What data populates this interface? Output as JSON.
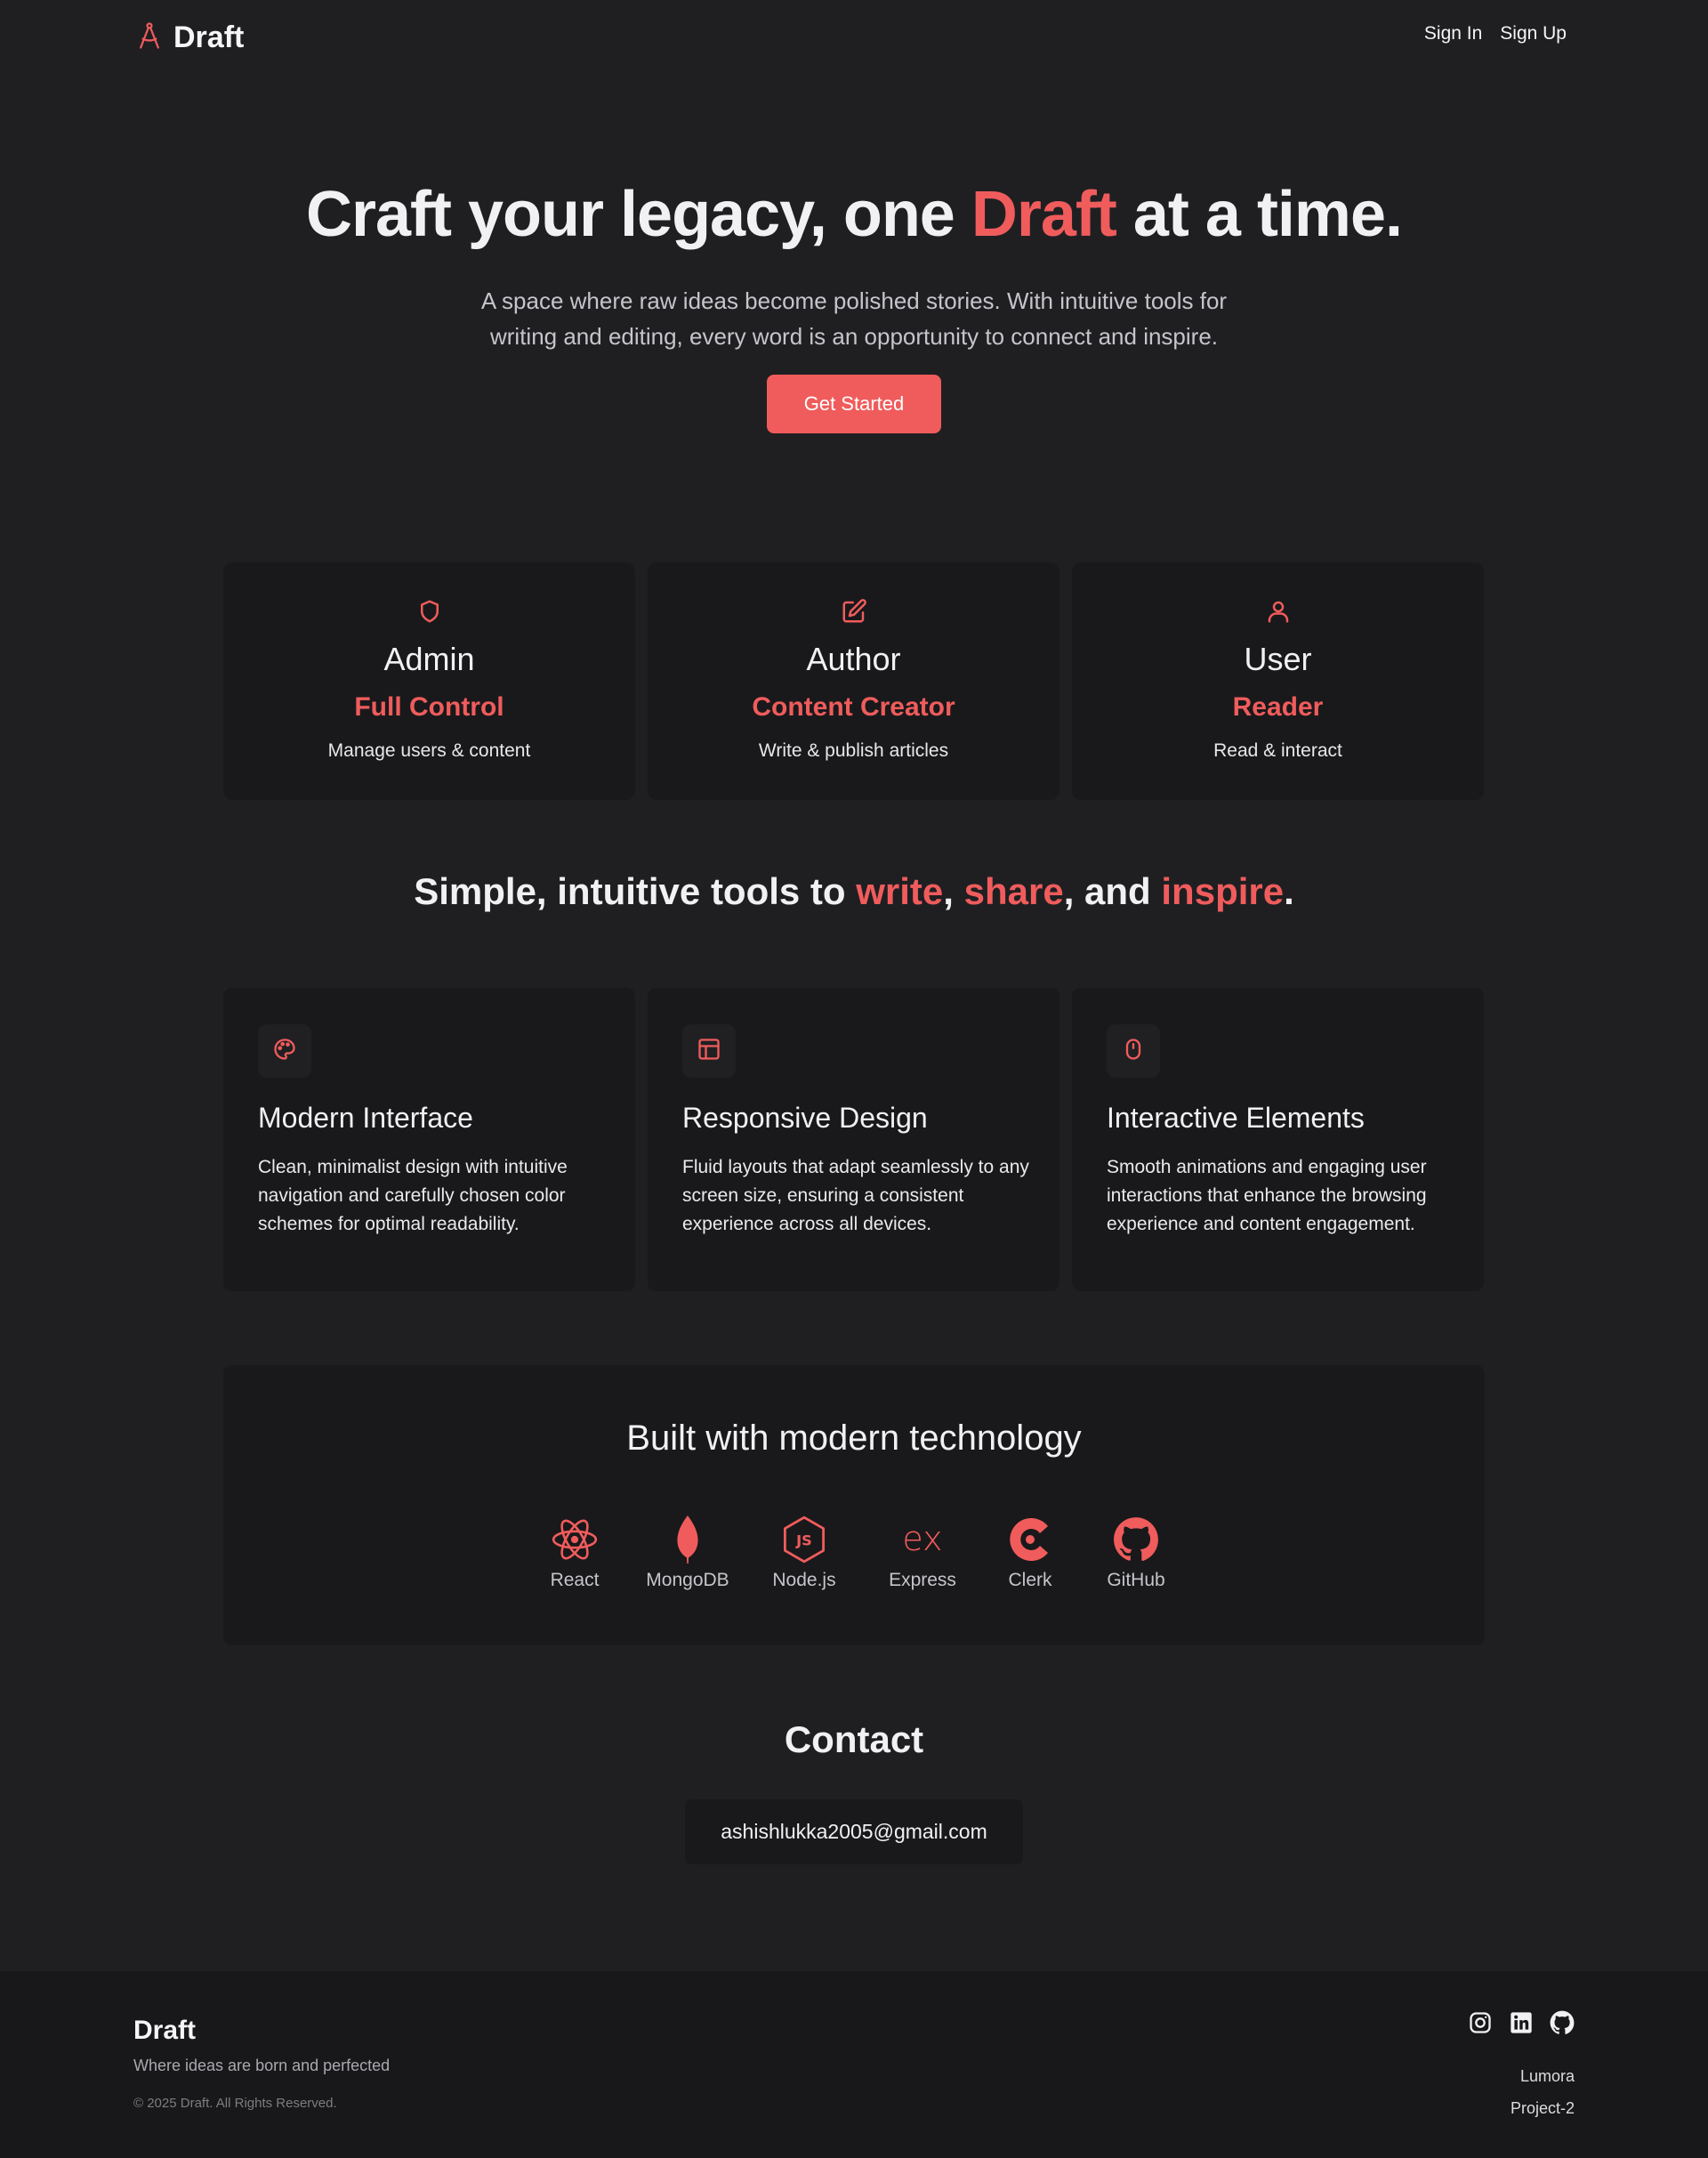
{
  "header": {
    "brand": "Draft",
    "sign_in": "Sign In",
    "sign_up": "Sign Up"
  },
  "hero": {
    "title_before": "Craft your legacy, one ",
    "title_accent": "Draft",
    "title_after": " at a time.",
    "subtitle_line1": "A space where raw ideas become polished stories. With intuitive tools for",
    "subtitle_line2": "writing and editing, every word is an opportunity to connect and inspire.",
    "cta": "Get Started"
  },
  "roles": [
    {
      "icon": "shield-icon",
      "title": "Admin",
      "subtitle": "Full Control",
      "desc": "Manage users & content"
    },
    {
      "icon": "pencil-square-icon",
      "title": "Author",
      "subtitle": "Content Creator",
      "desc": "Write & publish articles"
    },
    {
      "icon": "user-icon",
      "title": "User",
      "subtitle": "Reader",
      "desc": "Read & interact"
    }
  ],
  "tools_heading": {
    "p1": "Simple, intuitive tools to ",
    "w1": "write",
    "p2": ", ",
    "w2": "share",
    "p3": ", and ",
    "w3": "inspire",
    "p4": "."
  },
  "features": [
    {
      "icon": "palette-icon",
      "title": "Modern Interface",
      "desc": "Clean, minimalist design with intuitive navigation and carefully chosen color schemes for optimal readability."
    },
    {
      "icon": "layout-icon",
      "title": "Responsive Design",
      "desc": "Fluid layouts that adapt seamlessly to any screen size, ensuring a consistent experience across all devices."
    },
    {
      "icon": "mouse-icon",
      "title": "Interactive Elements",
      "desc": "Smooth animations and engaging user interactions that enhance the browsing experience and content engagement."
    }
  ],
  "tech": {
    "title": "Built with modern technology",
    "items": [
      "React",
      "MongoDB",
      "Node.js",
      "Express",
      "Clerk",
      "GitHub"
    ]
  },
  "contact": {
    "title": "Contact",
    "email": "ashishlukka2005@gmail.com"
  },
  "footer": {
    "brand": "Draft",
    "tagline": "Where ideas are born and perfected",
    "copyright": "© 2025 Draft. All Rights Reserved.",
    "link1": "Lumora",
    "link2": "Project-2"
  },
  "colors": {
    "accent": "#f05c5c",
    "background": "#1f1f22",
    "card": "#19191b"
  }
}
